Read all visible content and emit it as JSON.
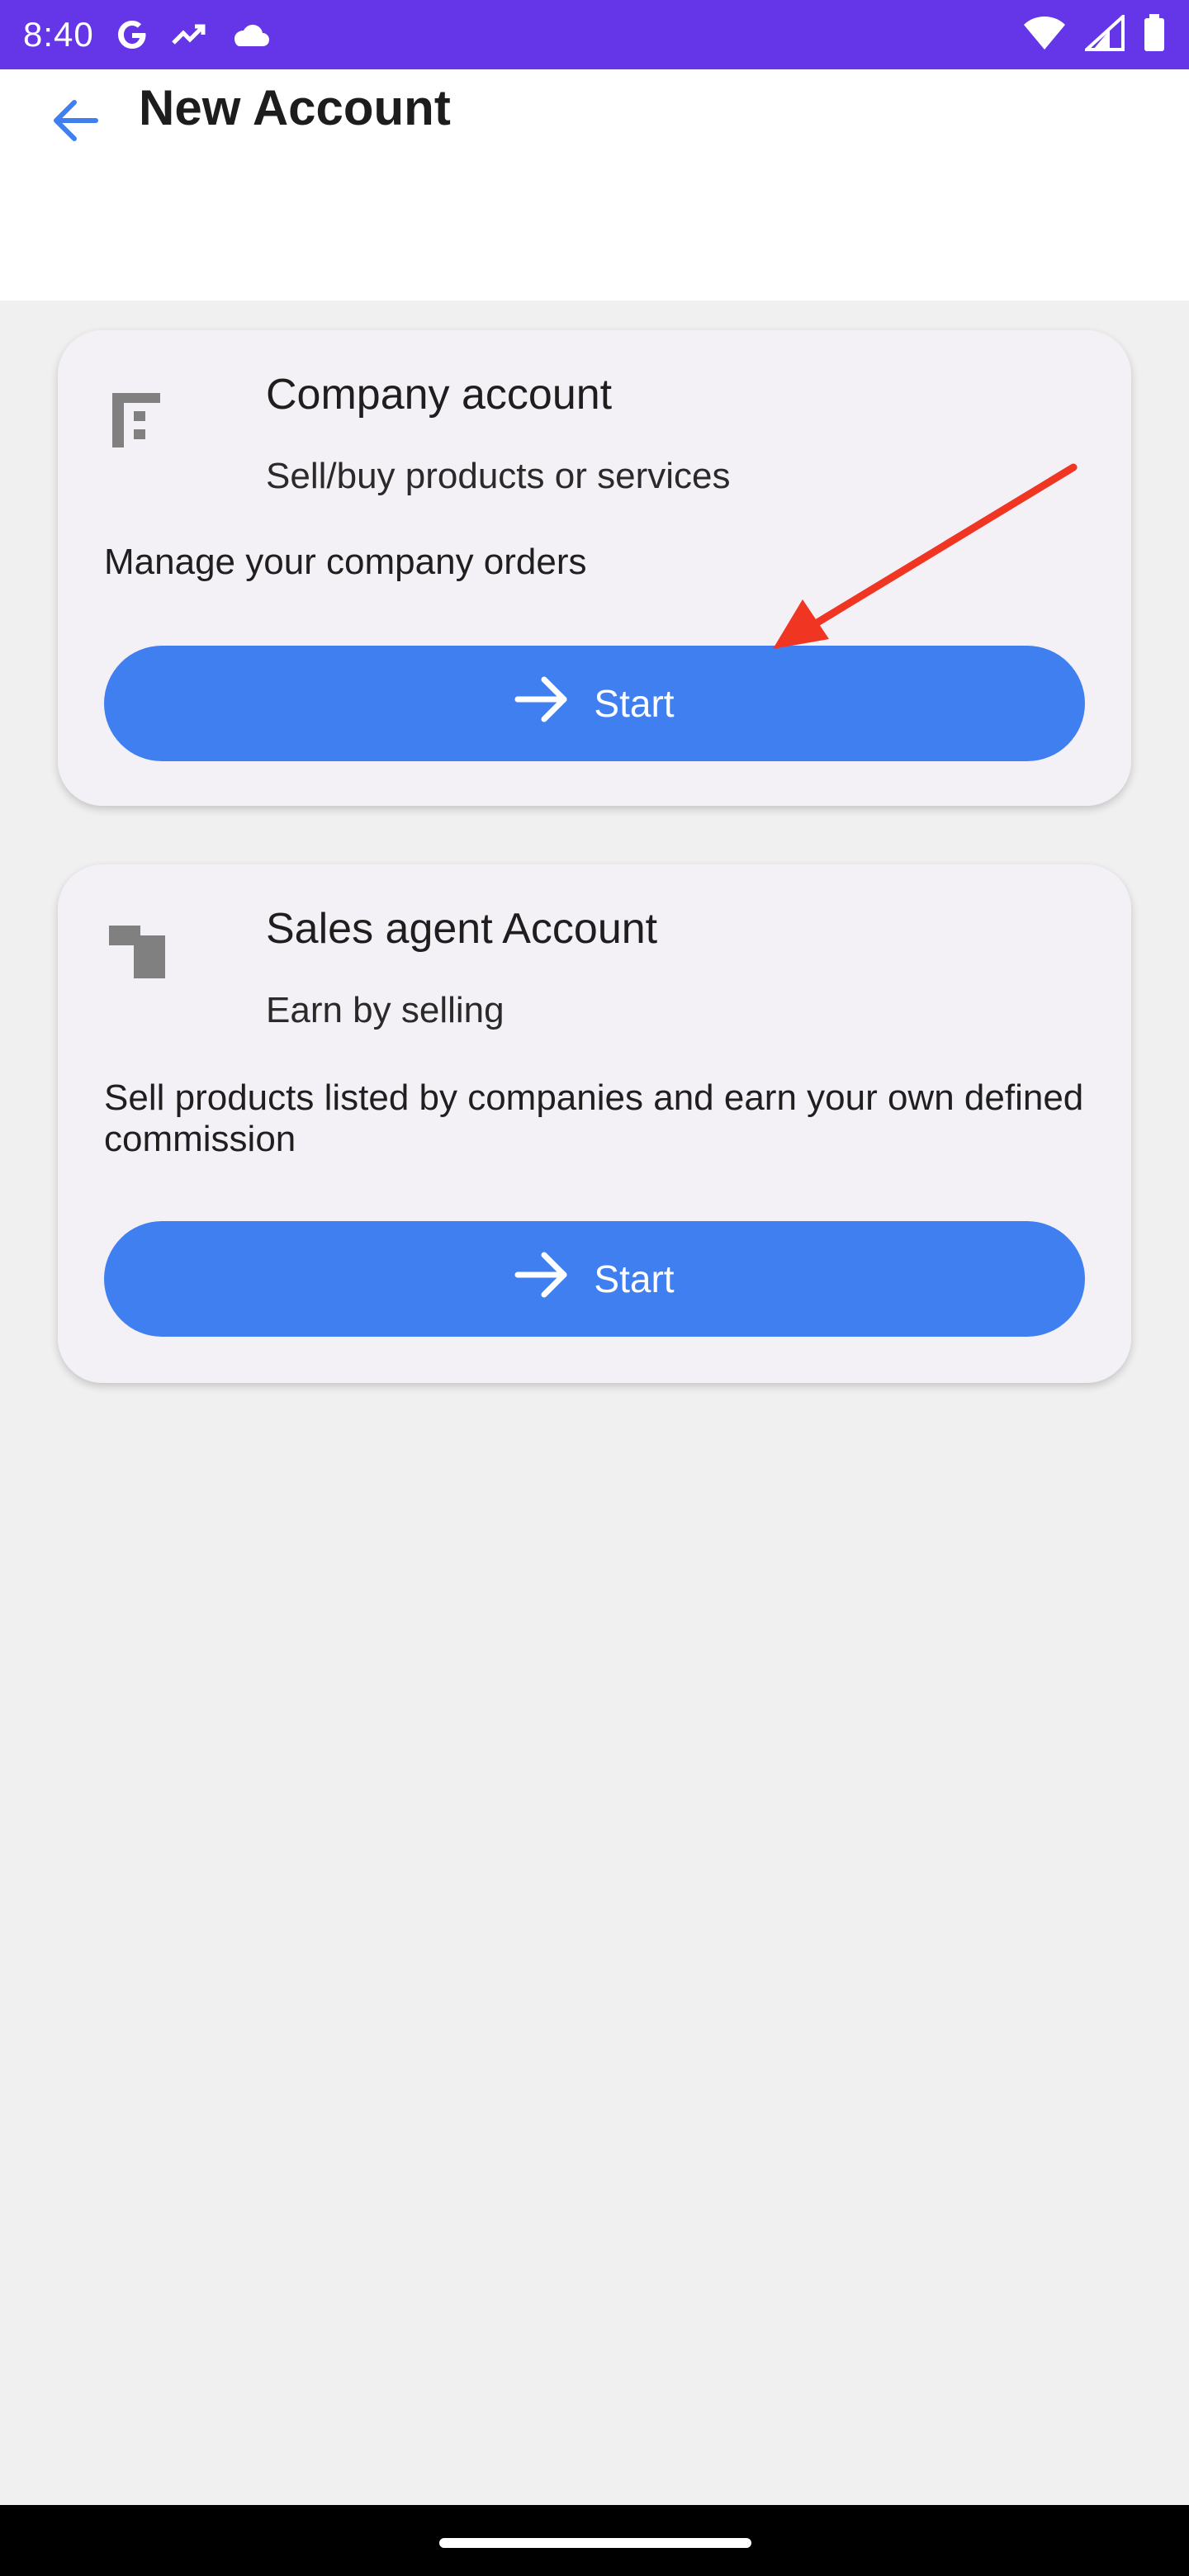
{
  "status_bar": {
    "time": "8:40",
    "left_icons": [
      "google-icon",
      "trending-icon",
      "cloud-icon"
    ],
    "right_icons": [
      "wifi-icon",
      "signal-icon",
      "battery-icon"
    ],
    "background": "#6436e8"
  },
  "header": {
    "title": "New Account",
    "back_icon": "arrow-back-icon"
  },
  "cards": [
    {
      "icon": "company-icon",
      "title": "Company account",
      "subtitle": "Sell/buy products or services",
      "description": "Manage your company orders",
      "button_label": "Start",
      "button_icon": "arrow-forward-icon"
    },
    {
      "icon": "sales-agent-icon",
      "title": "Sales agent Account",
      "subtitle": "Earn by selling",
      "description": "Sell products listed by companies and earn your own defined commission",
      "button_label": "Start",
      "button_icon": "arrow-forward-icon"
    }
  ],
  "colors": {
    "accent": "#3f7ff0",
    "annotation": "#f03522",
    "card_bg": "#f4f1f6",
    "page_bg": "#f0f0f0"
  }
}
